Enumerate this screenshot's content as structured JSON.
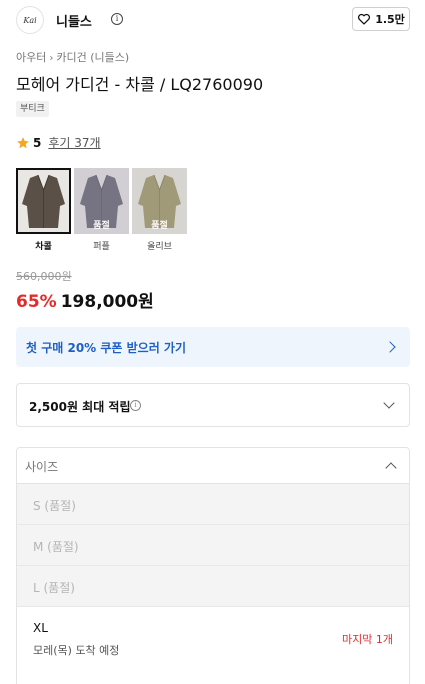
{
  "brand": {
    "logo_text": "Kai",
    "name": "니들스",
    "like_count": "1.5만"
  },
  "breadcrumb": [
    "아우터",
    "카디건 (니들스)"
  ],
  "product": {
    "title": "모헤어 가디건 - 차콜 / LQ2760090",
    "tag": "부티크"
  },
  "rating": {
    "score": "5",
    "review_text": "후기 37개"
  },
  "colors": [
    {
      "label": "차콜",
      "selected": true,
      "soldout": false,
      "soldout_text": "",
      "hex": "#5a5048"
    },
    {
      "label": "퍼플",
      "selected": false,
      "soldout": true,
      "soldout_text": "품절",
      "hex": "#2d2840"
    },
    {
      "label": "올리브",
      "selected": false,
      "soldout": true,
      "soldout_text": "품절",
      "hex": "#6f6430"
    }
  ],
  "price": {
    "original": "560,000원",
    "discount": "65%",
    "sale": "198,000원"
  },
  "coupon_banner": {
    "text": "첫 구매 20% 쿠폰 받으러 가기"
  },
  "points": {
    "text": "2,500원 최대 적립"
  },
  "size_select": {
    "label": "사이즈",
    "options_soldout": [
      "S (품절)",
      "M (품절)",
      "L (품절)"
    ],
    "available": {
      "size": "XL",
      "delivery": "모레(목) 도착 예정",
      "stock": "마지막 1개"
    }
  },
  "colors_accent": {
    "discount_red": "#e32b2b",
    "coupon_blue": "#1f5fc4",
    "star_orange": "#f5a623"
  }
}
